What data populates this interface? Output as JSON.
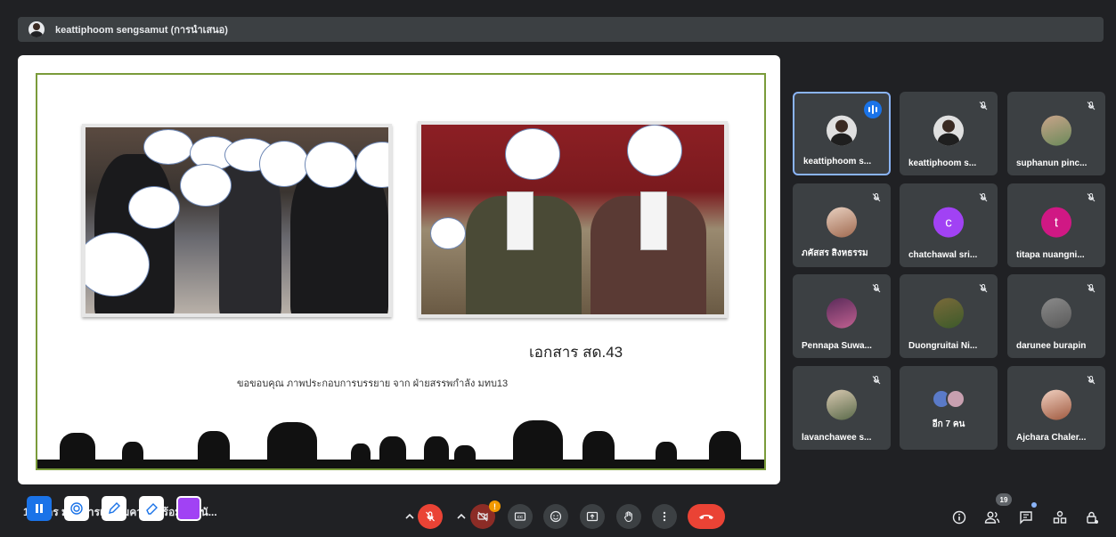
{
  "presenter": {
    "name": "keattiphoom sengsamut (การนำเสนอ)"
  },
  "slide": {
    "doc_title": "เอกสาร สด.43",
    "credit": "ขอขอบคุณ ภาพประกอบการบรรยาย จาก ฝ่ายสรรพกำลัง มทบ13"
  },
  "participants": [
    {
      "name": "keattiphoom s...",
      "state": "speaking"
    },
    {
      "name": "keattiphoom s...",
      "state": "muted"
    },
    {
      "name": "suphanun pinc...",
      "state": "muted"
    },
    {
      "name": "ภคัสสร สิงหธรรม",
      "state": "muted"
    },
    {
      "name": "chatchawal sri...",
      "state": "muted",
      "initial": "c"
    },
    {
      "name": "titapa nuangni...",
      "state": "muted",
      "initial": "t"
    },
    {
      "name": "Pennapa Suwa...",
      "state": "muted"
    },
    {
      "name": "Duongruitai Ni...",
      "state": "muted"
    },
    {
      "name": "darunee burapin",
      "state": "muted"
    },
    {
      "name": "lavanchawee s...",
      "state": "muted"
    },
    {
      "name": "อีก 7 คน",
      "state": "others"
    },
    {
      "name": "Ajchara Chaler...",
      "state": "muted"
    }
  ],
  "bottom_bar": {
    "meeting_title": "1 ้ ม ักร ม ): การเตรียมความพร้อมของนั...",
    "warning_badge": "!",
    "participant_count": "19"
  },
  "icons": [
    "pause-icon",
    "laser-pointer-icon",
    "pen-icon",
    "eraser-icon",
    "color-swatch",
    "chevron-up-icon",
    "mic-off-icon",
    "camera-off-icon",
    "captions-icon",
    "emoji-icon",
    "present-icon",
    "raise-hand-icon",
    "more-options-icon",
    "end-call-icon",
    "info-icon",
    "people-icon",
    "chat-icon",
    "activities-icon",
    "host-controls-icon"
  ],
  "colors": {
    "background": "#202124",
    "tile": "#3c4043",
    "accent_blue": "#1a73e8",
    "red": "#ea4335",
    "annotation_purple": "#a142f4"
  }
}
